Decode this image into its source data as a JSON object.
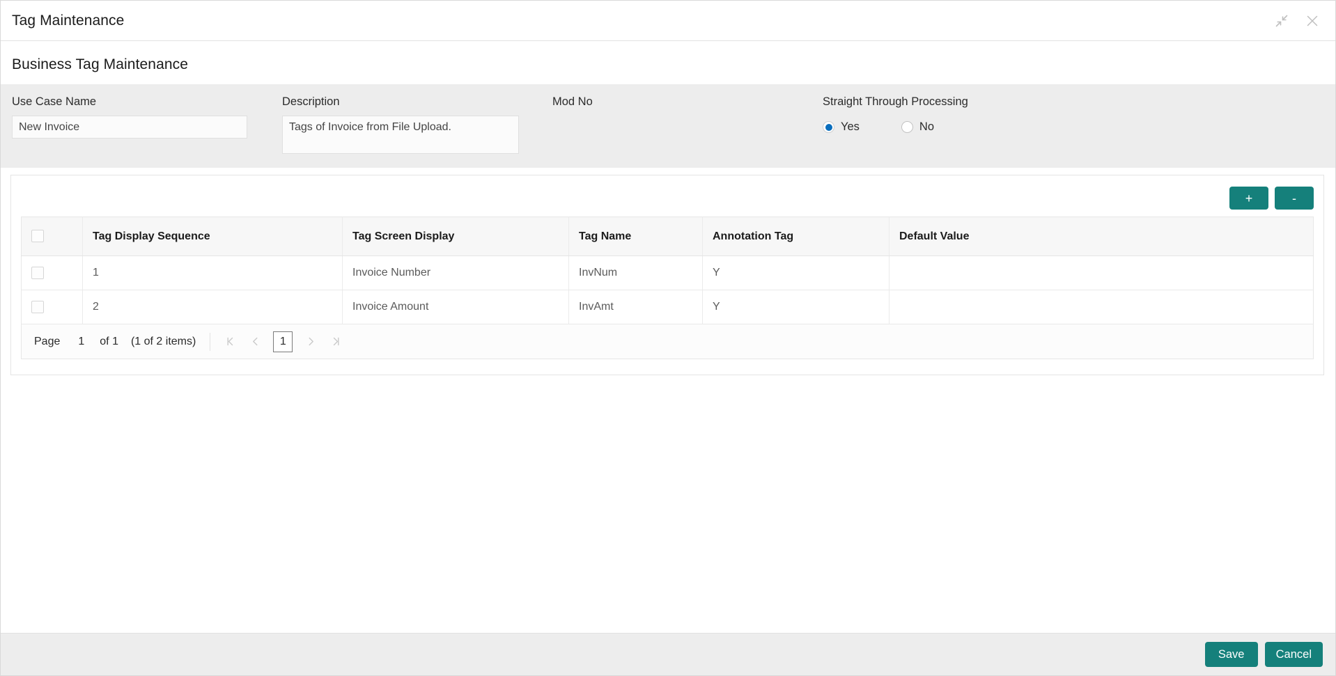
{
  "window": {
    "title": "Tag Maintenance",
    "icons": {
      "minimize": "collapse-arrows-icon",
      "close": "close-icon"
    }
  },
  "page": {
    "heading": "Business Tag Maintenance"
  },
  "form": {
    "use_case": {
      "label": "Use Case Name",
      "value": "New Invoice",
      "placeholder": ""
    },
    "description": {
      "label": "Description",
      "value": "Tags of Invoice from File Upload.",
      "placeholder": ""
    },
    "mod_no": {
      "label": "Mod No",
      "value": ""
    },
    "straight_through_processing": {
      "label": "Straight Through Processing",
      "selected": "Yes",
      "options": [
        {
          "label": "Yes",
          "selected": true
        },
        {
          "label": "No",
          "selected": false
        }
      ],
      "accent_color": "#0a6ebd"
    }
  },
  "toolbar": {
    "add_label": "+",
    "remove_label": "-",
    "button_color": "#15807B"
  },
  "table": {
    "columns": [
      "",
      "Tag Display Sequence",
      "Tag Screen Display",
      "Tag Name",
      "Annotation Tag",
      "Default Value"
    ],
    "rows": [
      {
        "selected": false,
        "sequence": "1",
        "screen_display": "Invoice Number",
        "tag_name": "InvNum",
        "annotation_tag": "Y",
        "default_value": ""
      },
      {
        "selected": false,
        "sequence": "2",
        "screen_display": "Invoice Amount",
        "tag_name": "InvAmt",
        "annotation_tag": "Y",
        "default_value": ""
      }
    ]
  },
  "pagination": {
    "page_word": "Page",
    "current_page": "1",
    "of_text": "of 1",
    "items_text": "(1 of 2 items)",
    "active_page": "1",
    "first_icon": "first-page-icon",
    "prev_icon": "previous-page-icon",
    "next_icon": "next-page-icon",
    "last_icon": "last-page-icon"
  },
  "footer": {
    "save_label": "Save",
    "cancel_label": "Cancel",
    "button_color": "#15807B"
  }
}
